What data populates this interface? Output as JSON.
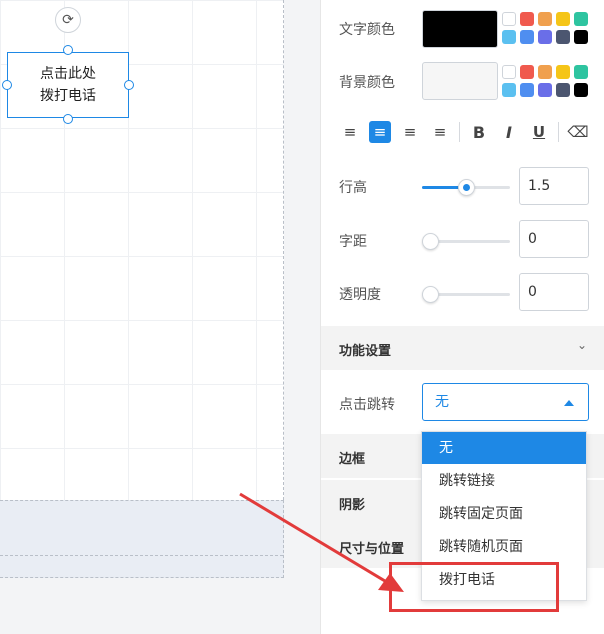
{
  "canvas": {
    "textbox_text": "点击此处\n拨打电话",
    "rotate_icon": "rotate-icon"
  },
  "panel": {
    "text_color_label": "文字颜色",
    "text_color_value": "#000000",
    "bg_color_label": "背景颜色",
    "bg_color_value": "#f6f6f6",
    "palette": [
      "#ffffff",
      "#f05a4e",
      "#f0a04e",
      "#f5c518",
      "#2ec4a0",
      "#5bc0f0",
      "#4f8ef0",
      "#6a6ee8",
      "#4c5670",
      "#000000"
    ],
    "format_buttons": [
      {
        "name": "align-left-icon",
        "glyph": "≡",
        "active": false
      },
      {
        "name": "align-center-icon",
        "glyph": "≡",
        "active": true
      },
      {
        "name": "align-right-icon",
        "glyph": "≡",
        "active": false
      },
      {
        "name": "align-justify-icon",
        "glyph": "≡",
        "active": false
      },
      {
        "name": "bold-icon",
        "glyph": "B",
        "active": false
      },
      {
        "name": "italic-icon",
        "glyph": "I",
        "active": false
      },
      {
        "name": "underline-icon",
        "glyph": "U",
        "active": false
      },
      {
        "name": "eraser-icon",
        "glyph": "⌫",
        "active": false
      }
    ],
    "line_height": {
      "label": "行高",
      "value": "1.5",
      "slider_fraction": 0.5
    },
    "letter_spacing": {
      "label": "字距",
      "value": "0",
      "slider_fraction": 0
    },
    "opacity": {
      "label": "透明度",
      "value": "0",
      "slider_fraction": 0
    },
    "function_section": {
      "title": "功能设置"
    },
    "click_jump": {
      "label": "点击跳转",
      "selected": "无",
      "options": [
        "无",
        "跳转链接",
        "跳转固定页面",
        "跳转随机页面",
        "拨打电话"
      ]
    },
    "border_section": {
      "title": "边框"
    },
    "shadow_section": {
      "title": "阴影"
    },
    "size_section": {
      "title": "尺寸与位置"
    }
  },
  "colors": {
    "accent": "#1e88e5",
    "annotation": "#e23b3b"
  }
}
